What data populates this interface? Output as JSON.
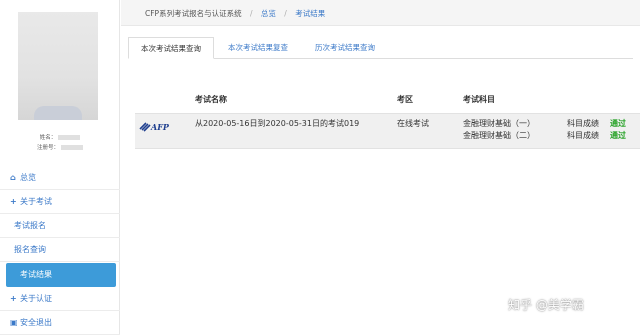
{
  "sidebar": {
    "profile": {
      "name_label": "姓名：",
      "reg_label": "注册号："
    },
    "menu": {
      "home": "总览",
      "about_exam": "关于考试",
      "exam_register": "考试报名",
      "register_query": "报名查询",
      "exam_result": "考试结果",
      "about_cert": "关于认证",
      "logout": "安全退出"
    }
  },
  "breadcrumb": {
    "root": "CFP系列考试报名与认证系统",
    "sep": "/",
    "home": "总览",
    "current": "考试结果"
  },
  "tabs": [
    {
      "label": "本次考试结果查询",
      "active": true
    },
    {
      "label": "本次考试结果复查",
      "active": false
    },
    {
      "label": "历次考试结果查询",
      "active": false
    }
  ],
  "table": {
    "headers": {
      "exam_name": "考试名称",
      "exam_area": "考区",
      "exam_subject": "考试科目"
    },
    "rows": [
      {
        "logo": "AFP",
        "exam_name": "从2020-05-16日到2020-05-31日的考试019",
        "exam_area": "在线考试",
        "subjects": [
          {
            "name": "金融理财基础（一）",
            "result_label": "科目成绩",
            "result": "通过"
          },
          {
            "name": "金融理财基础（二）",
            "result_label": "科目成绩",
            "result": "通过"
          }
        ]
      }
    ]
  },
  "watermark": "知乎 @美学霸",
  "colors": {
    "accent": "#3b79c8",
    "active_menu": "#3d9bd9",
    "pass": "#22a022"
  }
}
